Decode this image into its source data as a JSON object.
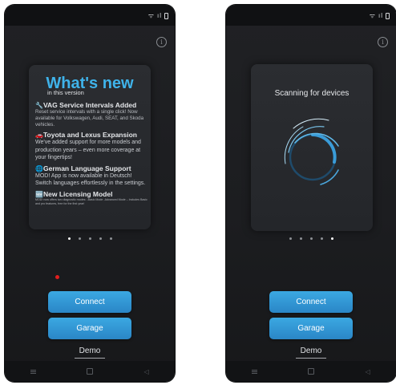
{
  "status": {
    "signal": "ᯤ",
    "label": "ıl"
  },
  "info_label": "i",
  "whats_new": {
    "title": "What's new",
    "subtitle": "in this version",
    "items": [
      {
        "icon": "🔧",
        "title": "VAG Service Intervals Added",
        "body": "Reset service intervals with a single click! Now available for Volkswagen, Audi, SEAT, and Skoda vehicles.",
        "size": "small"
      },
      {
        "icon": "🚗",
        "title": "Toyota and Lexus Expansion",
        "body": "We've added support for more models and production years – even more coverage at your fingertips!",
        "size": "big"
      },
      {
        "icon": "🌐",
        "title": "German Language Support",
        "body": "MOD! App is now available in Deutsch! Switch languages effortlessly in the settings.",
        "size": "big"
      },
      {
        "icon": "🆕",
        "title": "New Licensing Model",
        "body": "MOD! now offers two diagnostic modes: -Basic Mode -Advanced Mode – Includes Basic and pro features, free for the first year!",
        "size": "tiny"
      }
    ]
  },
  "scanning": {
    "title": "Scanning for devices"
  },
  "carousel": {
    "pages": 5,
    "left_active": 0,
    "right_active": 4
  },
  "buttons": {
    "connect": "Connect",
    "garage": "Garage",
    "demo": "Demo"
  },
  "nav": {
    "back": "◁"
  },
  "colors": {
    "accent": "#3fb3ea",
    "button": "#2f93d3",
    "background": "#1e1f22",
    "record_dot": "#e21e1e"
  }
}
